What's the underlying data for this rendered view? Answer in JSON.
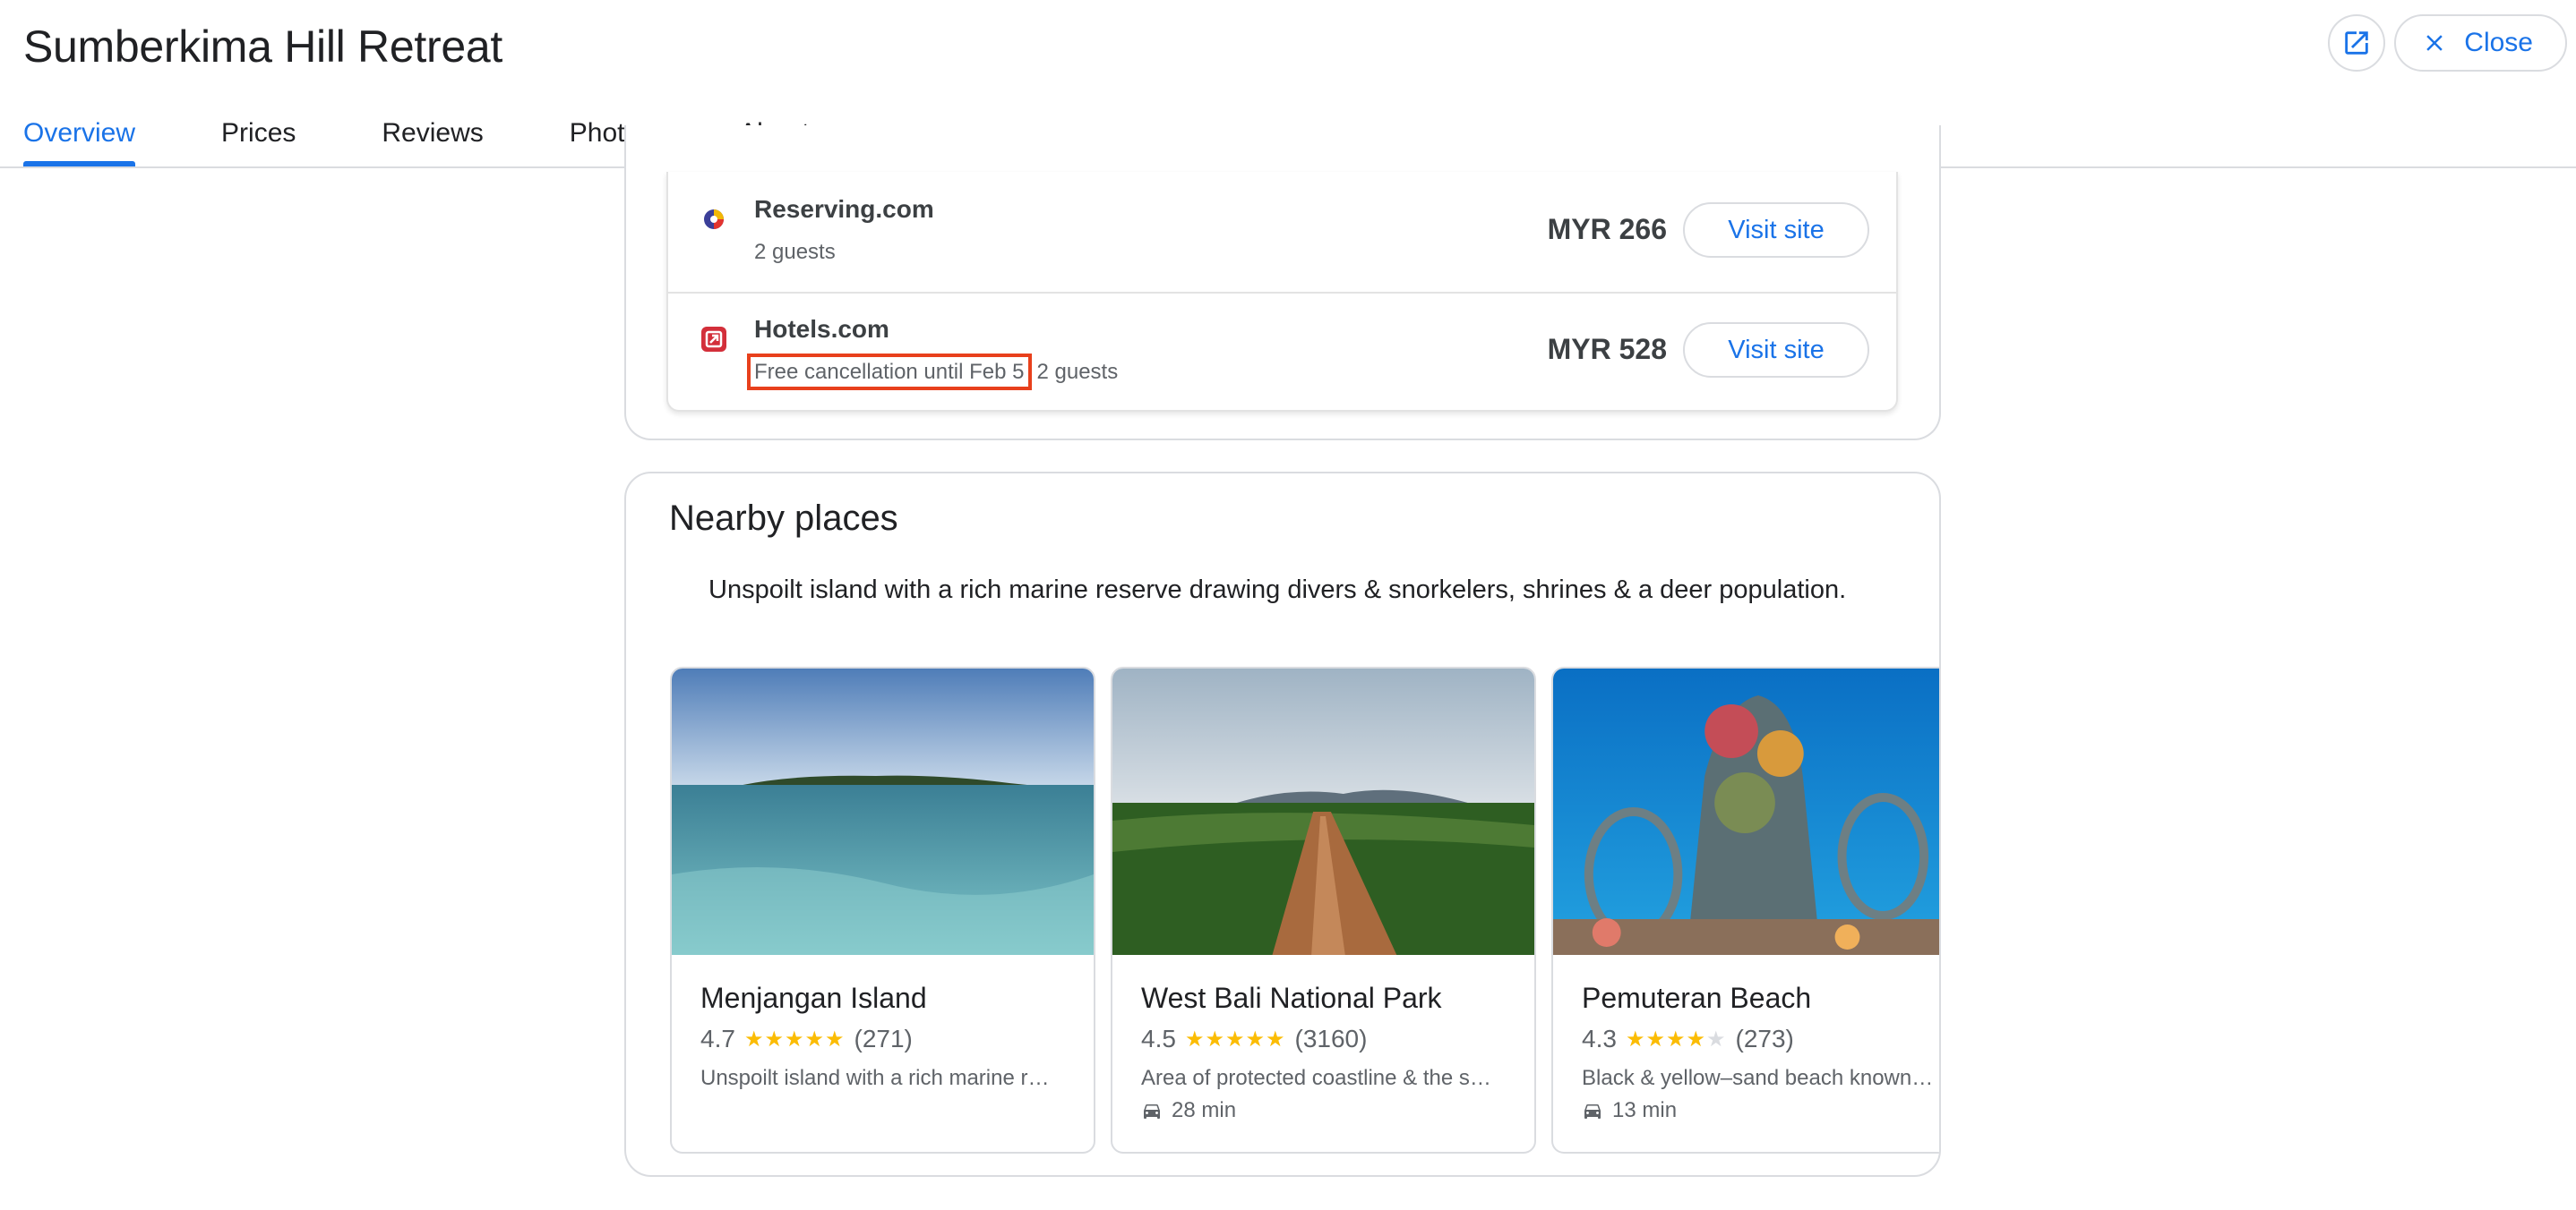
{
  "header": {
    "title": "Sumberkima Hill Retreat",
    "close_label": "Close"
  },
  "tabs": [
    {
      "label": "Overview",
      "active": true
    },
    {
      "label": "Prices"
    },
    {
      "label": "Reviews"
    },
    {
      "label": "Photos"
    },
    {
      "label": "About"
    }
  ],
  "prices": {
    "rows": [
      {
        "site": "Reserving.com",
        "details": "2 guests",
        "price": "MYR 266",
        "button": "Visit site"
      },
      {
        "site": "Hotels.com",
        "highlight": "Free cancellation until Feb 5",
        "details": "2 guests",
        "price": "MYR 528",
        "button": "Visit site"
      }
    ]
  },
  "nearby": {
    "title": "Nearby places",
    "description": "Unspoilt island with a rich marine reserve drawing divers & snorkelers, shrines & a deer population.",
    "places": [
      {
        "name": "Menjangan Island",
        "rating": "4.7",
        "stars_fraction": 0.94,
        "reviews": "(271)",
        "desc": "Unspoilt island with a rich marine r…",
        "drive": ""
      },
      {
        "name": "West Bali National Park",
        "rating": "4.5",
        "stars_fraction": 0.9,
        "reviews": "(3160)",
        "desc": "Area of protected coastline & the s…",
        "drive": "28 min"
      },
      {
        "name": "Pemuteran Beach",
        "rating": "4.3",
        "stars_fraction": 0.86,
        "reviews": "(273)",
        "desc": "Black & yellow–sand beach known…",
        "drive": "13 min"
      }
    ]
  },
  "colors": {
    "accent": "#1a73e8",
    "star": "#fbbc04",
    "highlight": "#e8401c"
  }
}
